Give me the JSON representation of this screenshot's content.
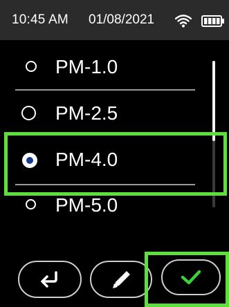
{
  "status_bar": {
    "time": "10:45 AM",
    "date": "01/08/2021",
    "wifi_icon": "wifi-icon",
    "battery_icon": "battery-full-icon"
  },
  "list": {
    "items": [
      {
        "label": "PM-1.0",
        "selected": false
      },
      {
        "label": "PM-2.5",
        "selected": false
      },
      {
        "label": "PM-4.0",
        "selected": true
      },
      {
        "label": "PM-5.0",
        "selected": false
      }
    ]
  },
  "footer": {
    "back_icon": "return-arrow-icon",
    "edit_icon": "pencil-icon",
    "confirm_icon": "checkmark-icon"
  },
  "colors": {
    "background": "#000000",
    "status_bar": "#2b2b2b",
    "highlight": "#5ee03b",
    "radio_selected_center": "#1b3a8f",
    "confirm_check": "#3ad13a"
  }
}
